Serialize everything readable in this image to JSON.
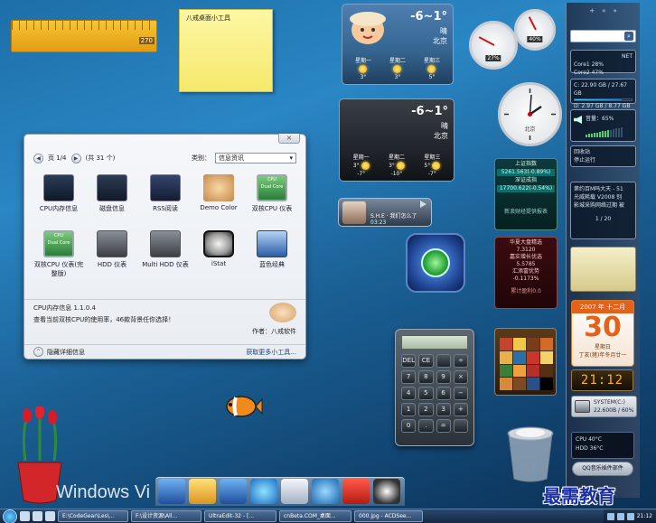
{
  "ruler": {
    "value": "270"
  },
  "note": {
    "text": "八戒桌面小工具"
  },
  "weather_large": {
    "temp": "-6~1°",
    "condition": "晴",
    "city": "北京",
    "days": [
      {
        "label": "星期一",
        "temp": "3°"
      },
      {
        "label": "星期二",
        "temp": "3°"
      },
      {
        "label": "星期三",
        "temp": "5°"
      }
    ]
  },
  "weather_small": {
    "temp": "-6~1°",
    "condition": "晴",
    "city": "北京",
    "days": [
      {
        "label": "星期一",
        "temp": "3°",
        "low": "-7°"
      },
      {
        "label": "星期二",
        "temp": "3°",
        "low": "-10°"
      },
      {
        "label": "星期三",
        "temp": "5°",
        "low": "-7°"
      }
    ]
  },
  "gauges": {
    "cpu_label": "27%",
    "mem_label": "40%",
    "cpu_value": 27,
    "mem_value": 40
  },
  "clock": {
    "city": "北京"
  },
  "sidebar": {
    "buttons": [
      "+",
      "«",
      "»"
    ],
    "net_title": "NET",
    "cores": [
      "Core1 28%",
      "Core2 47%"
    ],
    "drives": [
      "C: 22.90 GB / 27.67 GB",
      "D: 2.97 GB / 8.77 GB"
    ],
    "volume": "音量：65%",
    "volume_value": 65,
    "recycle": "回收站",
    "recycle_status": "停止运行",
    "news": [
      "第约百M吗大天 - 51",
      "光威耗载 V2008 别",
      "影城采购网络过期 被"
    ],
    "news_pager": "1 / 20"
  },
  "gadget_window": {
    "close_label": "×",
    "page_label": "页 1/4",
    "total_label": "(共 31 个)",
    "category_label": "类别：",
    "category_value": "信息资讯",
    "items": [
      {
        "label": "CPU内存信息",
        "icon": "monitor-icon"
      },
      {
        "label": "磁盘信息",
        "icon": "disk-icon"
      },
      {
        "label": "RSS阅读",
        "icon": "rss-icon"
      },
      {
        "label": "Demo Color",
        "icon": "person-icon"
      },
      {
        "label": "双核CPU 仪表",
        "icon": "cpu-meter-icon"
      },
      {
        "label": "双核CPU 仪表(完整版)",
        "icon": "cpu-meter-icon"
      },
      {
        "label": "HDD 仪表",
        "icon": "hdd-icon"
      },
      {
        "label": "Multi HDD 仪表",
        "icon": "hdd-icon"
      },
      {
        "label": "iStat",
        "icon": "gauge-icon"
      },
      {
        "label": "蓝色经典",
        "icon": "blue-gadget-icon"
      }
    ],
    "cpu_tile_label": "CPU",
    "dual_core_tile_label": "Dual Core",
    "info_title": "CPU内存信息 1.1.0.4",
    "info_desc": "查看当前双核CPU的使用率，46款背景任你选择！",
    "author": "作者：八戒软件",
    "hide_details": "隐藏详细信息",
    "get_more": "获取更多小工具..."
  },
  "player": {
    "title": "S.H.E · 我们怎么了",
    "time": "03:23"
  },
  "stocks": {
    "sh_label": "上证指数",
    "sh_value": "5261.563(-0.89%)",
    "sz_label": "深证成指",
    "sz_value": "17700.622(-0.54%)",
    "footer": "新浪财经提供报表"
  },
  "market": {
    "lines": [
      "华夏大盘精选",
      "7.3120",
      "嘉实增长优选",
      "5.5785",
      "汇添富优势",
      "-0.1173%"
    ],
    "footer": "累计盈利0.0"
  },
  "calculator": {
    "keys": [
      "DEL",
      "CE",
      "",
      "÷",
      "7",
      "8",
      "9",
      "×",
      "4",
      "5",
      "6",
      "−",
      "1",
      "2",
      "3",
      "+",
      "0",
      ".",
      "=",
      ""
    ]
  },
  "calendar": {
    "header": "2007 年 十二月",
    "day": "30",
    "week": "星期日",
    "lunar": "丁亥(猪)年冬月廿一"
  },
  "digital_clock": {
    "time": "21:12"
  },
  "system_drive": {
    "name": "SYSTEM(C:)",
    "usage": "22.600B / 60%"
  },
  "cpu_meter": {
    "cpu": "CPU 40°C",
    "hdd": "HDD 36°C"
  },
  "qq_widget": {
    "label": "QQ音乐插件部件"
  },
  "desktop": {
    "windows_text": "Windows Vi"
  },
  "watermark": "最需教育",
  "taskbar": {
    "tasks": [
      "E:\\CodeGear\\Les\\...",
      "F:\\设计资源\\All...",
      "UltraEdit-32 - [...",
      "cnBeta.COM_桌面...",
      "000.jpg - ACDSee..."
    ],
    "time": "21:12"
  },
  "colors": {
    "accent": "#1e6ab3",
    "calendar": "#e4611a",
    "stock_up": "#3bd17a",
    "stock_down": "#ff6a6a"
  }
}
